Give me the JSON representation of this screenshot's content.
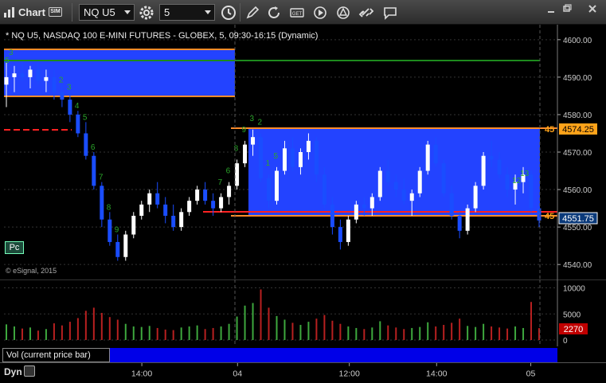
{
  "toolbar": {
    "title": "Chart",
    "sim_badge": "SIM",
    "symbol": "NQ U5",
    "interval": "5",
    "icons": [
      "chart-icon",
      "settings-icon",
      "clock-icon",
      "pencil-draw-icon",
      "refresh-icon",
      "get-quote-icon",
      "play-icon",
      "alert-icon",
      "link-icon",
      "comment-icon"
    ]
  },
  "study_header": "* NQ U5, NASDAQ 100 E-MINI FUTURES - GLOBEX, 5, 09:30-16:15 (Dynamic)",
  "copyright": "© eSignal, 2015",
  "pc_button": "Pc",
  "price_axis": {
    "ticks": [
      "4600.00",
      "4590.00",
      "4580.00",
      "4570.00",
      "4560.00",
      "4550.00",
      "4540.00"
    ],
    "tick_values": [
      4600,
      4590,
      4580,
      4570,
      4560,
      4550,
      4540
    ],
    "current_price": "4551.75",
    "upper_tag": "4574.25",
    "left_cut_upper": "45",
    "left_cut_lower": "45"
  },
  "volume_axis": {
    "ticks": [
      "10000",
      "5000",
      "0"
    ],
    "tick_values": [
      10000,
      5000,
      0
    ],
    "current_volume": "2270"
  },
  "time_axis": {
    "labels": [
      "14:00",
      "04",
      "12:00",
      "14:00",
      "05"
    ]
  },
  "volume_legend": "Vol (current price bar)",
  "dyn_label": "Dyn",
  "markers": {
    "early_top": "5",
    "early_top2": "3",
    "left_seq": [
      "2",
      "3",
      "4",
      "5",
      "6",
      "7",
      "8",
      "9"
    ],
    "mid_seq": [
      "7",
      "6",
      "8",
      "9",
      "3",
      "2",
      "1",
      "5"
    ],
    "right_seq": [
      "12",
      "13"
    ]
  },
  "colors": {
    "up_candle": "#ffffff",
    "down_candle": "#1a4dff",
    "range_box": "#2343ff",
    "orange_line": "#ff8c2a",
    "red_line": "#ff2222",
    "green_line": "#1d8a1d",
    "sequence_text": "#2aa52a",
    "vol_up": "#3ea83e",
    "vol_down": "#b82020",
    "price_tag_bg": "#ffa31a",
    "price_tag_dark": "#0b3a7a",
    "vol_tag_bg": "#c00000"
  },
  "chart_data": {
    "type": "candlestick",
    "ylim": [
      4536,
      4604
    ],
    "bars": [
      [
        4588,
        4594,
        4582,
        4590
      ],
      [
        4590,
        4593,
        4586,
        4591
      ],
      [
        4591,
        4594,
        4589,
        4590
      ],
      [
        4590,
        4593,
        4587,
        4592
      ],
      [
        4592,
        4594,
        4588,
        4589
      ],
      [
        4589,
        4592,
        4586,
        4590
      ],
      [
        4590,
        4592,
        4584,
        4586
      ],
      [
        4586,
        4588,
        4582,
        4584
      ],
      [
        4584,
        4586,
        4578,
        4580
      ],
      [
        4580,
        4581,
        4574,
        4575
      ],
      [
        4575,
        4578,
        4568,
        4569
      ],
      [
        4569,
        4570,
        4560,
        4561
      ],
      [
        4561,
        4562,
        4550,
        4552
      ],
      [
        4552,
        4554,
        4545,
        4546
      ],
      [
        4546,
        4548,
        4541,
        4542
      ],
      [
        4542,
        4549,
        4541,
        4548
      ],
      [
        4548,
        4554,
        4547,
        4553
      ],
      [
        4553,
        4557,
        4552,
        4556
      ],
      [
        4556,
        4560,
        4554,
        4559
      ],
      [
        4559,
        4562,
        4555,
        4556
      ],
      [
        4556,
        4558,
        4551,
        4553
      ],
      [
        4553,
        4556,
        4549,
        4550
      ],
      [
        4550,
        4555,
        4549,
        4554
      ],
      [
        4554,
        4558,
        4553,
        4557
      ],
      [
        4557,
        4561,
        4556,
        4560
      ],
      [
        4560,
        4562,
        4556,
        4557
      ],
      [
        4557,
        4559,
        4553,
        4555
      ],
      [
        4555,
        4559,
        4554,
        4558
      ],
      [
        4558,
        4562,
        4556,
        4561
      ],
      [
        4561,
        4568,
        4560,
        4567
      ],
      [
        4567,
        4573,
        4566,
        4572
      ],
      [
        4572,
        4576,
        4569,
        4574
      ],
      [
        4574,
        4575,
        4562,
        4563
      ],
      [
        4563,
        4564,
        4555,
        4557
      ],
      [
        4557,
        4566,
        4556,
        4565
      ],
      [
        4565,
        4573,
        4564,
        4571
      ],
      [
        4571,
        4574,
        4565,
        4566
      ],
      [
        4566,
        4571,
        4564,
        4570
      ],
      [
        4570,
        4575,
        4568,
        4573
      ],
      [
        4573,
        4574,
        4562,
        4564
      ],
      [
        4564,
        4566,
        4555,
        4556
      ],
      [
        4556,
        4558,
        4548,
        4550
      ],
      [
        4550,
        4552,
        4544,
        4546
      ],
      [
        4546,
        4553,
        4545,
        4552
      ],
      [
        4552,
        4557,
        4551,
        4556
      ],
      [
        4556,
        4558,
        4553,
        4555
      ],
      [
        4555,
        4559,
        4553,
        4558
      ],
      [
        4558,
        4566,
        4557,
        4565
      ],
      [
        4565,
        4568,
        4561,
        4562
      ],
      [
        4562,
        4564,
        4558,
        4560
      ],
      [
        4560,
        4563,
        4556,
        4557
      ],
      [
        4557,
        4560,
        4553,
        4559
      ],
      [
        4559,
        4566,
        4558,
        4565
      ],
      [
        4565,
        4573,
        4564,
        4572
      ],
      [
        4572,
        4574,
        4566,
        4567
      ],
      [
        4567,
        4568,
        4558,
        4559
      ],
      [
        4559,
        4561,
        4552,
        4553
      ],
      [
        4553,
        4554,
        4547,
        4549
      ],
      [
        4549,
        4556,
        4548,
        4555
      ],
      [
        4555,
        4562,
        4554,
        4561
      ],
      [
        4561,
        4570,
        4560,
        4569
      ],
      [
        4569,
        4573,
        4566,
        4568
      ],
      [
        4568,
        4570,
        4563,
        4564
      ],
      [
        4564,
        4566,
        4558,
        4560
      ],
      [
        4560,
        4564,
        4556,
        4562
      ],
      [
        4562,
        4566,
        4559,
        4564
      ],
      [
        4564,
        4565,
        4554,
        4555
      ],
      [
        4555,
        4556,
        4550,
        4551.75
      ]
    ],
    "volume": [
      3000,
      2600,
      2200,
      2400,
      1800,
      2100,
      3200,
      2800,
      3500,
      4200,
      5600,
      6200,
      5200,
      4400,
      3900,
      3100,
      2600,
      2500,
      2700,
      2300,
      2000,
      1900,
      2400,
      2600,
      2800,
      2100,
      2300,
      2600,
      3100,
      4500,
      6600,
      7100,
      9700,
      6200,
      4600,
      3900,
      3300,
      2900,
      3500,
      4100,
      4800,
      3700,
      3100,
      2600,
      2300,
      2100,
      2400,
      3600,
      2800,
      2400,
      2100,
      2300,
      2500,
      3400,
      2600,
      2900,
      3300,
      4100,
      2700,
      2500,
      3100,
      2600,
      2400,
      2200,
      2600,
      2300,
      7300,
      2270
    ]
  }
}
